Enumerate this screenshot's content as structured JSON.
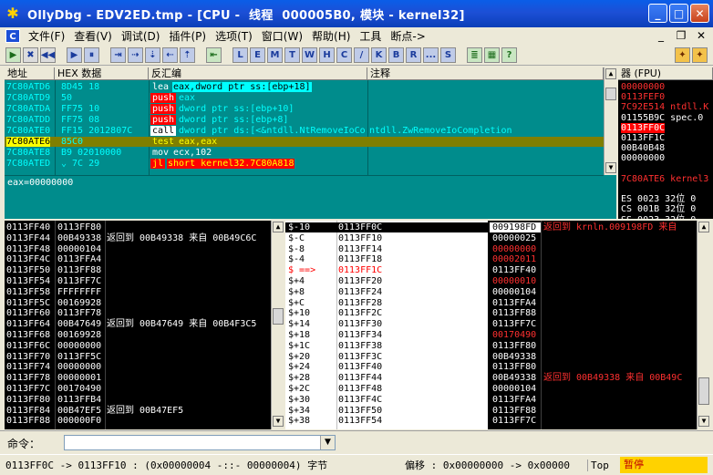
{
  "window": {
    "title": "OllyDbg - EDV2ED.tmp - [CPU -  线程  000005B0, 模块 - kernel32]",
    "logo": "✱"
  },
  "menu": [
    "文件(F)",
    "查看(V)",
    "调试(D)",
    "插件(P)",
    "选项(T)",
    "窗口(W)",
    "帮助(H)",
    "工具",
    "断点->"
  ],
  "mdi_label": "C",
  "toolbar": {
    "left": [
      "▶",
      "✖",
      "◀◀",
      "▶",
      "⏸",
      "⇥",
      "⇢",
      "⇣",
      "⇠",
      "⇡",
      "⇤"
    ],
    "letters": [
      "L",
      "E",
      "M",
      "T",
      "W",
      "H",
      "C",
      "/",
      "K",
      "B",
      "R",
      "...",
      "S"
    ],
    "right": [
      "≣",
      "▦",
      "?"
    ]
  },
  "disasm": {
    "headers": {
      "addr": "地址",
      "hex": "HEX 数据",
      "asm": "反汇编",
      "comment": "注释"
    },
    "rows": [
      {
        "addr": "7C80ATD6",
        "hex": "8D45 18",
        "mnem": "lea",
        "ops": "eax,dword ptr ss:[ebp+18]",
        "cmt": ""
      },
      {
        "addr": "7C80ATD9",
        "hex": "50",
        "mnem": "push",
        "ops": "eax",
        "cmt": ""
      },
      {
        "addr": "7C80ATDA",
        "hex": "FF75 10",
        "mnem": "push",
        "ops": "dword ptr ss:[ebp+10]",
        "cmt": ""
      },
      {
        "addr": "7C80ATDD",
        "hex": "FF75 08",
        "mnem": "push",
        "ops": "dword ptr ss:[ebp+8]",
        "cmt": ""
      },
      {
        "addr": "7C80ATE0",
        "hex": "FF15 2012807C",
        "mnem": "call",
        "ops": "dword ptr ds:[<&ntdll.NtRemoveIoCo",
        "cmt": "ntdll.ZwRemoveIoCompletion"
      },
      {
        "addr": "7C80ATE6",
        "hex": "85C0",
        "mnem": "test",
        "ops": "eax,eax",
        "cmt": ""
      },
      {
        "addr": "7C80ATE8",
        "hex": "B9 02010000",
        "mnem": "mov",
        "ops": "ecx,102",
        "cmt": ""
      },
      {
        "addr": "7C80ATED",
        "hex": "⌄ 7C 29",
        "mnem": "jl",
        "ops": "short kernel32.7C80A818",
        "cmt": ""
      }
    ],
    "info": "eax=00000000"
  },
  "registers": {
    "header": "器 (FPU)",
    "lines": [
      "00000000",
      "0113FEF0",
      "7C92E514 ntdll.K",
      "01155B9C spec.0",
      "0113FF0C",
      "0113FF1C",
      "00B40B48",
      "00000000",
      "",
      "7C80ATE6 kernel3",
      "",
      "ES 0023 32位 0",
      "CS 001B 32位 0",
      "SS 0023 32位 0"
    ]
  },
  "dump": {
    "rows": [
      [
        "0113FF40",
        "0113FF80",
        ""
      ],
      [
        "0113FF44",
        "00B49338",
        "返回到 00B49338 来自 00B49C6C"
      ],
      [
        "0113FF48",
        "00000104",
        ""
      ],
      [
        "0113FF4C",
        "0113FFA4",
        ""
      ],
      [
        "0113FF50",
        "0113FF88",
        ""
      ],
      [
        "0113FF54",
        "0113FF7C",
        ""
      ],
      [
        "0113FF58",
        "FFFFFFFF",
        ""
      ],
      [
        "0113FF5C",
        "00169928",
        ""
      ],
      [
        "0113FF60",
        "0113FF78",
        ""
      ],
      [
        "0113FF64",
        "00B47649",
        "返回到 00B47649 来自 00B4F3C5"
      ],
      [
        "0113FF68",
        "00169928",
        ""
      ],
      [
        "0113FF6C",
        "00000000",
        ""
      ],
      [
        "0113FF70",
        "0113FF5C",
        ""
      ],
      [
        "0113FF74",
        "00000000",
        ""
      ],
      [
        "0113FF78",
        "00000001",
        ""
      ],
      [
        "0113FF7C",
        "00170490",
        ""
      ],
      [
        "0113FF80",
        "0113FFB4",
        ""
      ],
      [
        "0113FF84",
        "00B47EF5",
        "返回到 00B47EF5"
      ],
      [
        "0113FF88",
        "000000F0",
        ""
      ]
    ]
  },
  "stack_offsets": {
    "rows": [
      [
        "$-10",
        "0113FF0C"
      ],
      [
        "$-C",
        "0113FF10"
      ],
      [
        "$-8",
        "0113FF14"
      ],
      [
        "$-4",
        "0113FF18"
      ],
      [
        "$ ==>",
        "0113FF1C"
      ],
      [
        "$+4",
        "0113FF20"
      ],
      [
        "$+8",
        "0113FF24"
      ],
      [
        "$+C",
        "0113FF28"
      ],
      [
        "$+10",
        "0113FF2C"
      ],
      [
        "$+14",
        "0113FF30"
      ],
      [
        "$+18",
        "0113FF34"
      ],
      [
        "$+1C",
        "0113FF38"
      ],
      [
        "$+20",
        "0113FF3C"
      ],
      [
        "$+24",
        "0113FF40"
      ],
      [
        "$+28",
        "0113FF44"
      ],
      [
        "$+2C",
        "0113FF48"
      ],
      [
        "$+30",
        "0113FF4C"
      ],
      [
        "$+34",
        "0113FF50"
      ],
      [
        "$+38",
        "0113FF54"
      ]
    ]
  },
  "stack_values": {
    "rows": [
      [
        "009198FD",
        "返回到 krnln.009198FD 来自"
      ],
      [
        "00000025",
        ""
      ],
      [
        "00000000",
        ""
      ],
      [
        "00002011",
        ""
      ],
      [
        "0113FF40",
        ""
      ],
      [
        "00000010",
        ""
      ],
      [
        "00000104",
        ""
      ],
      [
        "0113FFA4",
        ""
      ],
      [
        "0113FF88",
        ""
      ],
      [
        "0113FF7C",
        ""
      ],
      [
        "00170490",
        ""
      ],
      [
        "0113FF80",
        ""
      ],
      [
        "00B49338",
        ""
      ],
      [
        "0113FF80",
        ""
      ],
      [
        "00B49338",
        "返回到 00B49338 来自 00B49C"
      ],
      [
        "00000104",
        ""
      ],
      [
        "0113FFA4",
        ""
      ],
      [
        "0113FF88",
        ""
      ],
      [
        "0113FF7C",
        ""
      ]
    ]
  },
  "command": {
    "label": "命令：",
    "value": ""
  },
  "status": {
    "text": "0113FF0C -> 0113FF10 : (0x00000004  -::-   00000004) 字节",
    "offset": "偏移 : 0x00000000 -> 0x00000",
    "top": "Top",
    "state": "暂停"
  },
  "colors": {
    "cyan": "#008c8c",
    "red": "#ff0000",
    "yellow": "#ffff00",
    "pause": "#ffd200"
  }
}
